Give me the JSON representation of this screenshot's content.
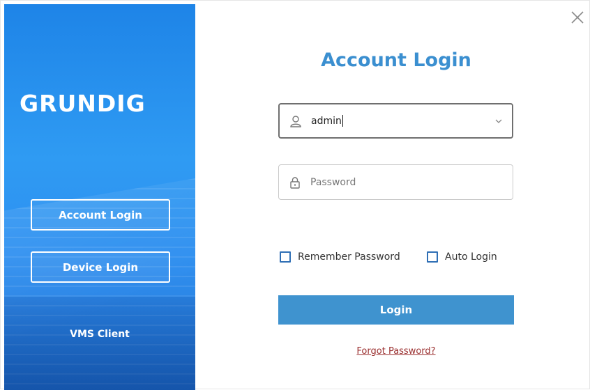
{
  "brand": {
    "logo_text": "GRUNDIG"
  },
  "nav": {
    "account_login": "Account Login",
    "device_login": "Device Login",
    "client_label": "VMS Client"
  },
  "form": {
    "title": "Account Login",
    "username_value": "admin",
    "password_placeholder": "Password",
    "remember_label": "Remember Password",
    "auto_login_label": "Auto Login",
    "login_button": "Login",
    "forgot_link": "Forgot Password?"
  },
  "colors": {
    "accent": "#3f93cf",
    "title": "#3b8fd0",
    "left_panel": "#2f9bf3",
    "link": "#9b3030"
  },
  "icons": [
    "close-icon",
    "user-icon",
    "lock-icon",
    "chevron-down-icon"
  ]
}
